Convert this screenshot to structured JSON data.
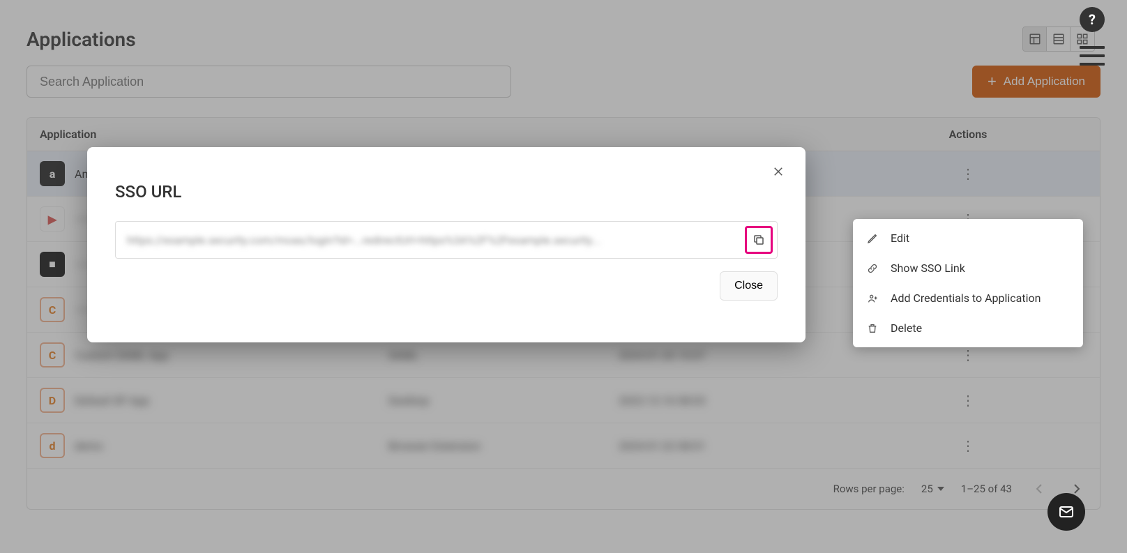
{
  "header": {
    "title": "Applications"
  },
  "search": {
    "placeholder": "Search Application"
  },
  "toolbar": {
    "add_label": "Add Application"
  },
  "columns": {
    "application": "Application",
    "actions": "Actions"
  },
  "rows": [
    {
      "app_first_letters": "An"
    },
    {
      "app_first_letters": ""
    },
    {
      "app_first_letters": ""
    },
    {
      "app_first_letters": ""
    },
    {
      "app_first_letters": ""
    },
    {
      "app_first_letters": ""
    },
    {
      "app_first_letters": ""
    }
  ],
  "pagination": {
    "rows_label": "Rows per page:",
    "rows_value": "25",
    "range_label": "1–25 of 43"
  },
  "context_menu": {
    "edit": "Edit",
    "show_sso": "Show SSO Link",
    "add_creds": "Add Credentials to Application",
    "delete": "Delete"
  },
  "modal": {
    "title": "SSO URL",
    "url_blurred": "https://example.security.com/moas/login?id=...redirectUrl=https%3A%2F%2Fexample.security...",
    "close_label": "Close"
  },
  "icons": {
    "help": "?",
    "plus": "+"
  }
}
